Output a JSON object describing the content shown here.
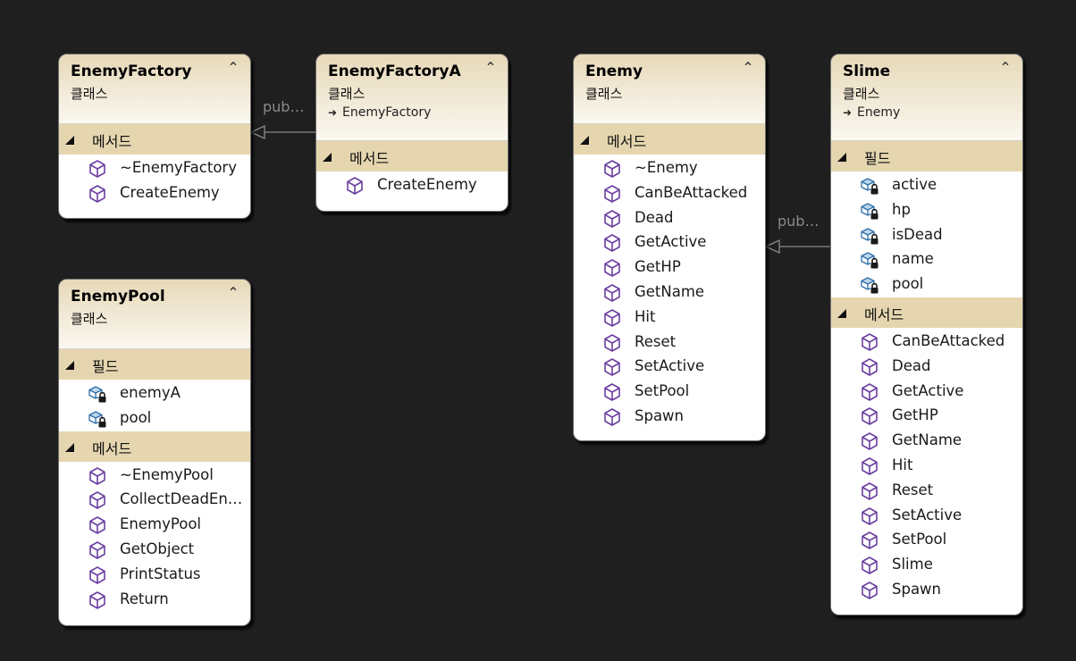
{
  "diagram": {
    "connectors": [
      {
        "label": "pub…",
        "from": "EnemyFactoryA",
        "to": "EnemyFactory"
      },
      {
        "label": "pub…",
        "from": "Slime",
        "to": "Enemy"
      }
    ],
    "classes": {
      "enemy_factory": {
        "title": "EnemyFactory",
        "kind": "클래스",
        "methods_label": "메서드",
        "methods": [
          "~EnemyFactory",
          "CreateEnemy"
        ]
      },
      "enemy_factory_a": {
        "title": "EnemyFactoryA",
        "kind": "클래스",
        "base": "EnemyFactory",
        "methods_label": "메서드",
        "methods": [
          "CreateEnemy"
        ]
      },
      "enemy": {
        "title": "Enemy",
        "kind": "클래스",
        "methods_label": "메서드",
        "methods": [
          "~Enemy",
          "CanBeAttacked",
          "Dead",
          "GetActive",
          "GetHP",
          "GetName",
          "Hit",
          "Reset",
          "SetActive",
          "SetPool",
          "Spawn"
        ]
      },
      "slime": {
        "title": "Slime",
        "kind": "클래스",
        "base": "Enemy",
        "fields_label": "필드",
        "fields": [
          "active",
          "hp",
          "isDead",
          "name",
          "pool"
        ],
        "methods_label": "메서드",
        "methods": [
          "CanBeAttacked",
          "Dead",
          "GetActive",
          "GetHP",
          "GetName",
          "Hit",
          "Reset",
          "SetActive",
          "SetPool",
          "Slime",
          "Spawn"
        ]
      },
      "enemy_pool": {
        "title": "EnemyPool",
        "kind": "클래스",
        "fields_label": "필드",
        "fields": [
          "enemyA",
          "pool"
        ],
        "methods_label": "메서드",
        "methods": [
          "~EnemyPool",
          "CollectDeadEn…",
          "EnemyPool",
          "GetObject",
          "PrintStatus",
          "Return"
        ]
      }
    }
  },
  "icons": {
    "method": "method-cube-icon",
    "field": "private-field-icon",
    "collapse": "double-chevron-up-icon",
    "inherit": "inheritance-arrow-icon",
    "section": "expanded-triangle-icon"
  },
  "colors": {
    "background": "#1f1f1f",
    "header_top": "#e7d9b8",
    "section": "#e5d6b0",
    "method_icon": "#6b3fa0",
    "field_icon": "#2e6fa8",
    "connector": "#8a8a8a"
  }
}
